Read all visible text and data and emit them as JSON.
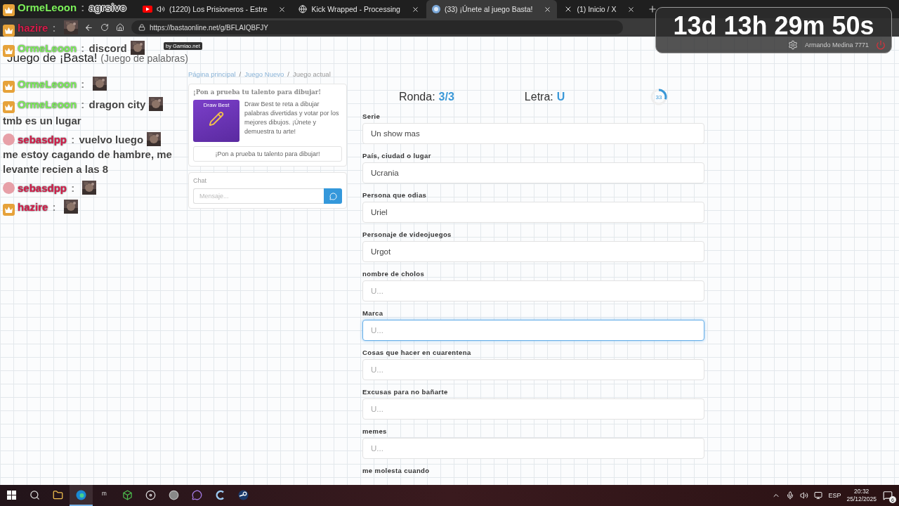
{
  "stream_chat": {
    "separator": ":",
    "messages": [
      {
        "kind": "crown",
        "user": "OrmeLeoon",
        "color": "#7cf05a",
        "parts": [
          {
            "kind": "text",
            "text": "agrsivo"
          }
        ]
      },
      {
        "kind": "crown",
        "user": "hazire",
        "color": "#d81b4a",
        "parts": [
          {
            "kind": "emote"
          }
        ]
      },
      {
        "kind": "crown",
        "user": "OrmeLeoon",
        "color": "#7cf05a",
        "parts": [
          {
            "kind": "text",
            "text": "discord"
          },
          {
            "kind": "emote"
          }
        ]
      },
      {
        "kind": "crown",
        "user": "OrmeLeoon",
        "color": "#7cf05a",
        "parts": [
          {
            "kind": "emote"
          }
        ]
      },
      {
        "kind": "crown",
        "user": "OrmeLeoon",
        "color": "#7cf05a",
        "parts": [
          {
            "kind": "text",
            "text": "dragon city"
          },
          {
            "kind": "emote"
          },
          {
            "kind": "text",
            "text": "tmb es un lugar"
          }
        ]
      },
      {
        "kind": "round",
        "user": "sebasdpp",
        "color": "#d81b4a",
        "parts": [
          {
            "kind": "text",
            "text": "vuelvo luego"
          },
          {
            "kind": "emote"
          },
          {
            "kind": "text",
            "text": "me estoy cagando de hambre, me levante recien a las 8"
          }
        ]
      },
      {
        "kind": "round",
        "user": "sebasdpp",
        "color": "#d81b4a",
        "parts": [
          {
            "kind": "emote"
          }
        ]
      },
      {
        "kind": "crown",
        "user": "hazire",
        "color": "#d81b4a",
        "parts": [
          {
            "kind": "emote"
          }
        ]
      }
    ]
  },
  "browser": {
    "tabs": [
      {
        "kind": "youtube",
        "audio": true,
        "title": "(1220) Los Prisioneros - Estre",
        "selected": false
      },
      {
        "kind": "globe",
        "audio": false,
        "title": "Kick Wrapped - Processing",
        "selected": false
      },
      {
        "kind": "site",
        "audio": false,
        "title": "(33) ¡Únete al juego Basta!",
        "selected": true
      },
      {
        "kind": "x",
        "audio": false,
        "title": "(1) Inicio / X",
        "selected": false
      }
    ],
    "url": "https://bastaonline.net/g/BFLAIQBFJY"
  },
  "timer_overlay": {
    "time": "13d 13h 29m 50s",
    "user": "Armando Medina 7771"
  },
  "page": {
    "credit": "by Gamiao.net",
    "title": "Juego de ¡Basta!",
    "subtitle": "(Juego de palabras)",
    "breadcrumb_separator": "/",
    "breadcrumb": [
      {
        "label": "Página principal",
        "current": false
      },
      {
        "label": "Juego Nuevo",
        "current": false
      },
      {
        "label": "Juego actual",
        "current": true
      }
    ],
    "promo": {
      "title": "¡Pon a prueba tu talento para dibujar!",
      "image_title": "Draw Best",
      "text": "Draw Best te reta a dibujar palabras divertidas y votar por los mejores dibujos. ¡Únete y demuestra tu arte!",
      "button": "¡Pon a prueba tu talento para dibujar!"
    },
    "chat": {
      "title": "Chat",
      "placeholder": "Mensaje..."
    }
  },
  "game": {
    "round_label": "Ronda:",
    "round": "3/3",
    "letter_label": "Letra:",
    "letter": "U",
    "countdown": {
      "value": "33"
    },
    "fields": [
      {
        "label": "Serie",
        "value": "Un show mas",
        "focused": false
      },
      {
        "label": "País, ciudad o lugar",
        "value": "Ucrania",
        "focused": false
      },
      {
        "label": "Persona que odias",
        "value": "Uriel",
        "focused": false
      },
      {
        "label": "Personaje de videojuegos",
        "value": "Urgot",
        "focused": false
      },
      {
        "label": "nombre de cholos",
        "placeholder": "U...",
        "focused": false
      },
      {
        "label": "Marca",
        "placeholder": "U...",
        "focused": true
      },
      {
        "label": "Cosas que hacer en cuarentena",
        "placeholder": "U...",
        "focused": false
      },
      {
        "label": "Excusas para no bañarte",
        "placeholder": "U...",
        "focused": false
      },
      {
        "label": "memes",
        "placeholder": "U...",
        "focused": false
      },
      {
        "label": "me molesta cuando"
      }
    ]
  },
  "taskbar": {
    "apps": [
      {
        "kind": "start",
        "selected": false
      },
      {
        "kind": "search",
        "selected": false
      },
      {
        "kind": "folder",
        "selected": false
      },
      {
        "kind": "browser",
        "selected": true
      },
      {
        "kind": "text",
        "label": "ᵐ",
        "selected": false
      },
      {
        "kind": "cube",
        "selected": false
      },
      {
        "kind": "record",
        "selected": false
      },
      {
        "kind": "disc",
        "selected": false
      },
      {
        "kind": "chat",
        "selected": false
      },
      {
        "kind": "letter",
        "selected": false
      },
      {
        "kind": "steam",
        "selected": false
      }
    ],
    "language": "ESP",
    "time": "20:32",
    "date": "25/12/2025",
    "notifications": "6"
  }
}
